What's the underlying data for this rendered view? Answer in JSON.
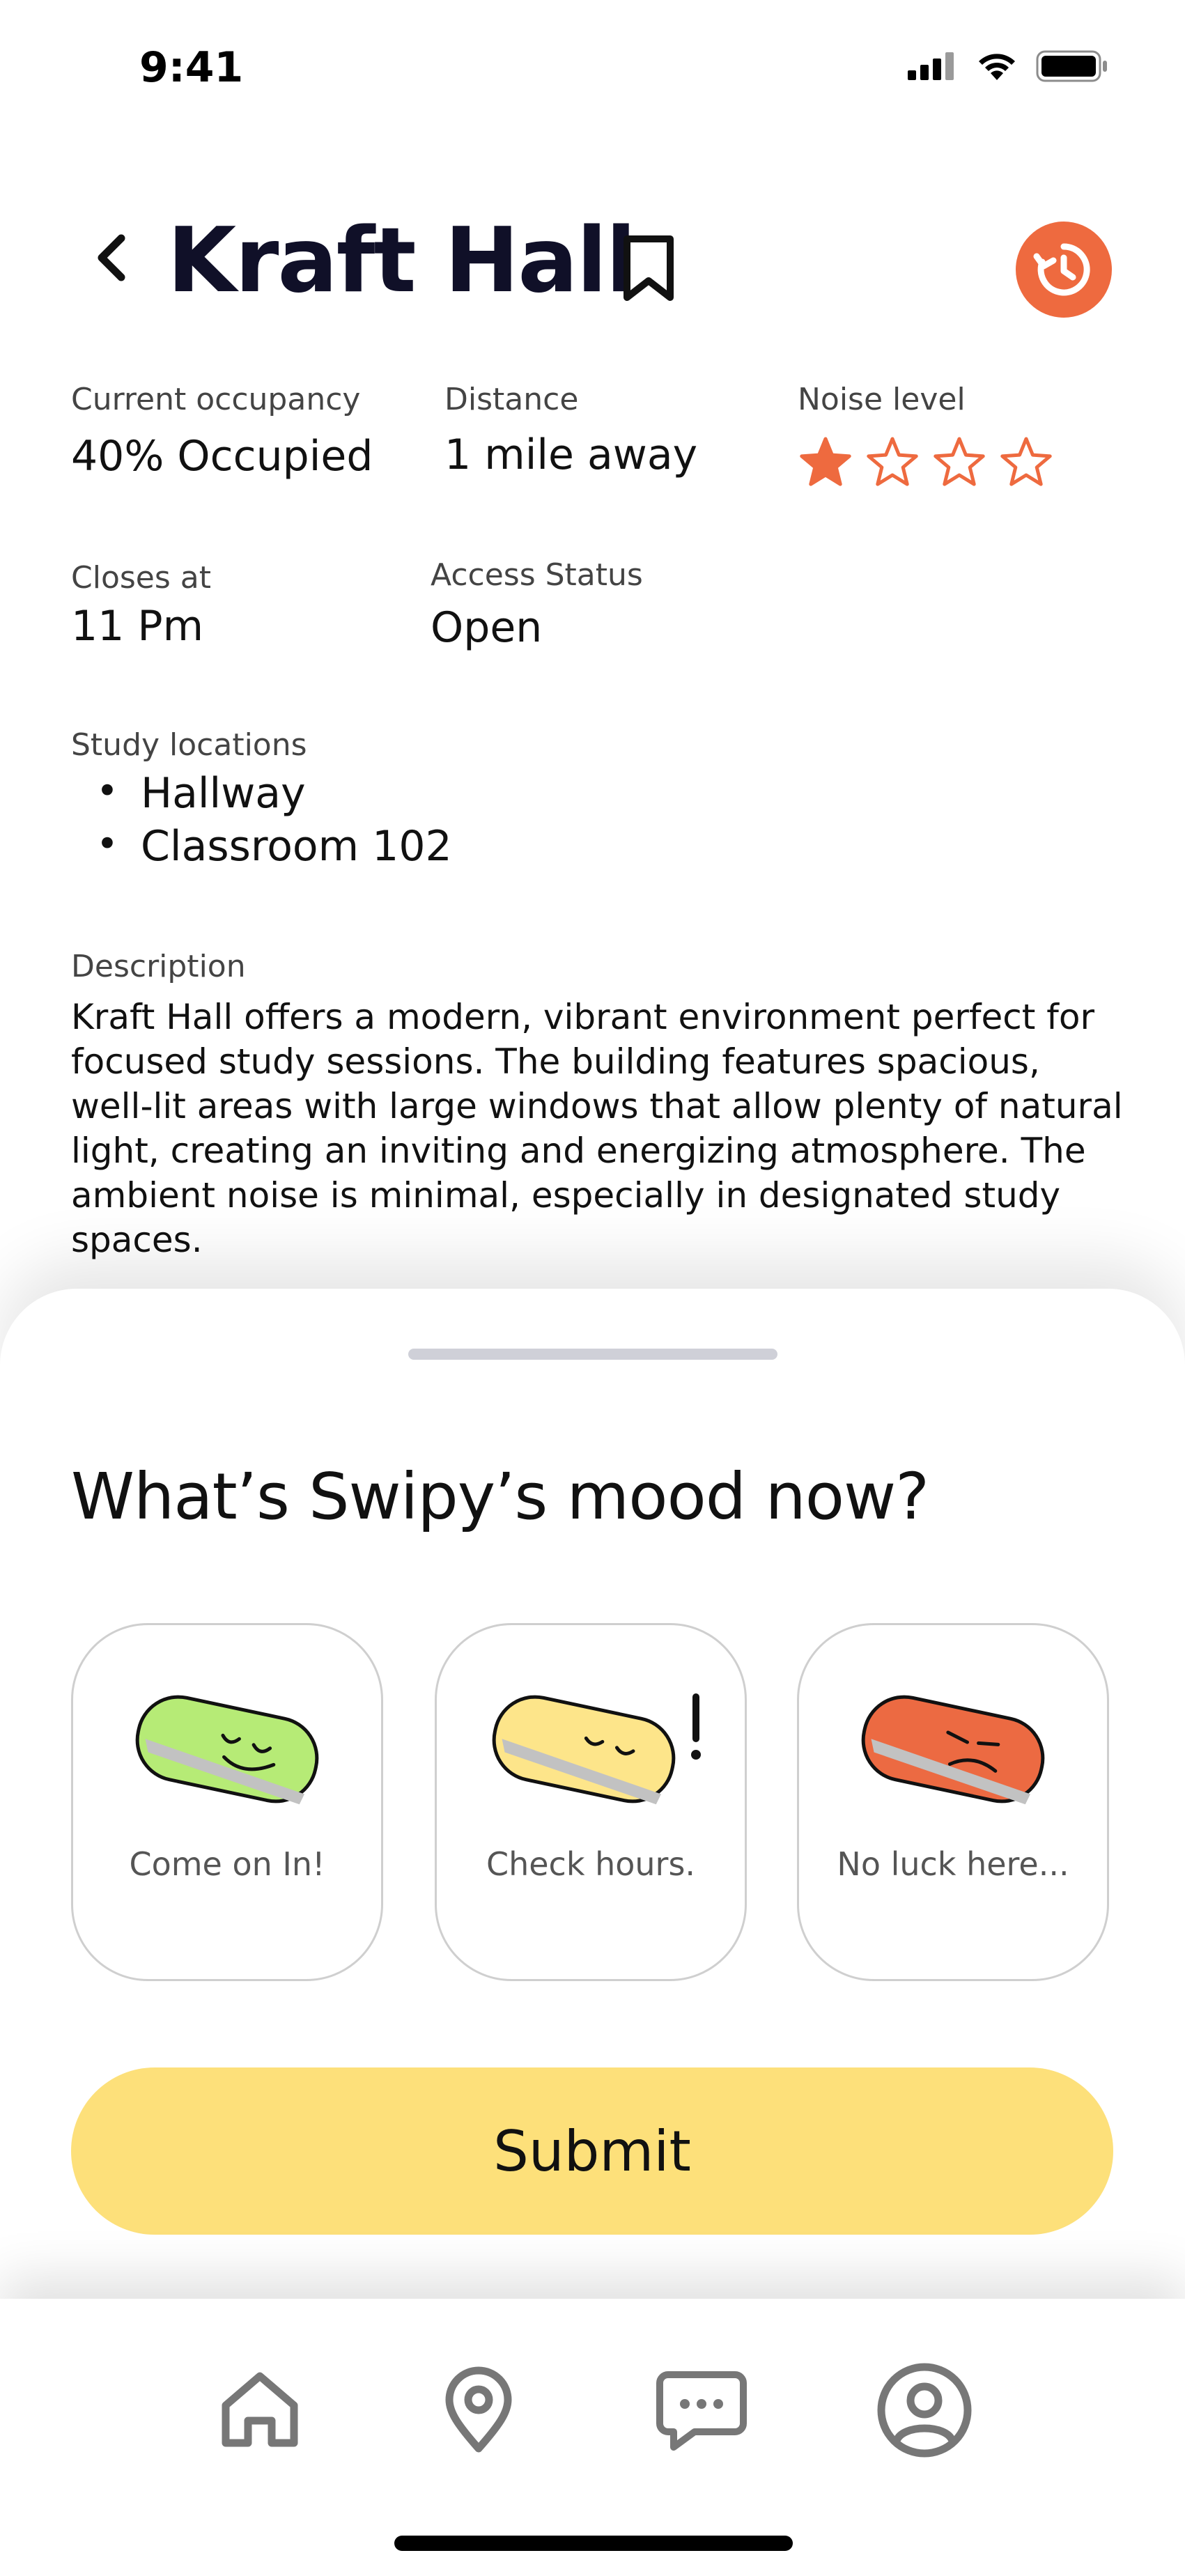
{
  "status_bar": {
    "time": "9:41"
  },
  "header": {
    "title": "Kraft Hall"
  },
  "info": {
    "occupancy_label": "Current occupancy",
    "occupancy_value": "40% Occupied",
    "distance_label": "Distance",
    "distance_value": "1 mile away",
    "noise_label": "Noise level",
    "noise_rating": 1,
    "noise_max": 4,
    "closes_label": "Closes at",
    "closes_value": "11 Pm",
    "access_label": "Access Status",
    "access_value": "Open",
    "study_label": "Study locations",
    "study_locations": [
      "Hallway",
      "Classroom 102"
    ],
    "description_label": "Description",
    "description": "Kraft Hall offers a modern, vibrant environment perfect for focused  study sessions. The building features spacious, well-lit areas with large windows that allow plenty of natural light, creating an inviting and energizing atmosphere. The ambient noise is minimal, especially in designated study spaces."
  },
  "mood_sheet": {
    "title": "What’s Swipy’s mood now?",
    "options": [
      {
        "label": "Come on In!",
        "color": "#b6eb76"
      },
      {
        "label": "Check hours.",
        "color": "#fde58a"
      },
      {
        "label": "No luck here...",
        "color": "#ec6a42"
      }
    ],
    "submit_label": "Submit"
  },
  "colors": {
    "accent": "#ee6a3f",
    "submit": "#fde07a",
    "nav_icon": "#777777"
  },
  "nav": [
    "home-icon",
    "location-pin-icon",
    "chat-icon",
    "profile-icon"
  ]
}
